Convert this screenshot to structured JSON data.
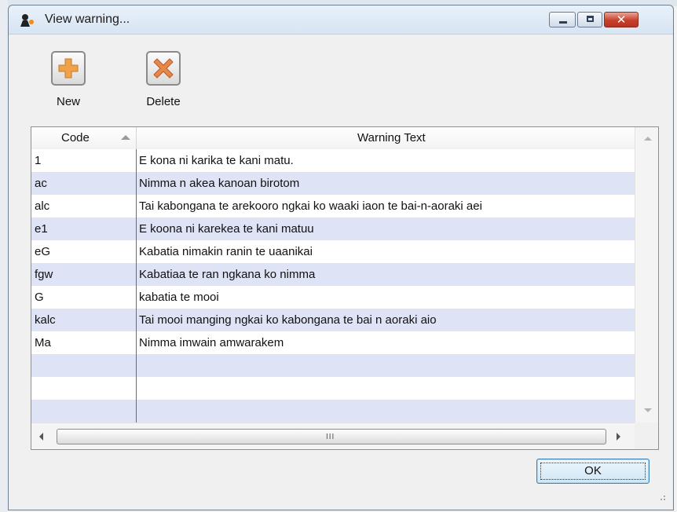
{
  "window": {
    "title": "View warning...",
    "controls": {
      "minimize": "minimize",
      "maximize": "maximize",
      "close": "close"
    }
  },
  "toolbar": {
    "new_label": "New",
    "delete_label": "Deletе"
  },
  "grid": {
    "columns": [
      "Code",
      "Warning Text"
    ],
    "sorted_by": "Code",
    "rows": [
      {
        "code": "1",
        "text": "E kona ni karika te kani matu."
      },
      {
        "code": "ac",
        "text": "Nimma n akea kanoan birotom"
      },
      {
        "code": "alc",
        "text": "Tai kabongana te arekooro ngkai ko waaki iaon te bai-n-aoraki aei"
      },
      {
        "code": "e1",
        "text": "E koona ni karekea te kani matuu"
      },
      {
        "code": "eG",
        "text": "Kabatia nimakin ranin te uaanikai"
      },
      {
        "code": "fgw",
        "text": "Kabatiaa te ran ngkana ko nimma"
      },
      {
        "code": "G",
        "text": "kabatia te mooi"
      },
      {
        "code": "kalc",
        "text": "Tai mooi manging ngkai ko kabongana te bai n aoraki aio"
      },
      {
        "code": "Ma",
        "text": "Nimma imwain amwarakem"
      },
      {
        "code": "",
        "text": ""
      },
      {
        "code": "",
        "text": ""
      },
      {
        "code": "",
        "text": ""
      }
    ],
    "hscroll_grip": "III"
  },
  "footer": {
    "ok_label": "OK"
  },
  "colors": {
    "alt_row": "#dfe3f6",
    "new_icon": "#f0a24a",
    "delete_icon": "#e8874a"
  }
}
